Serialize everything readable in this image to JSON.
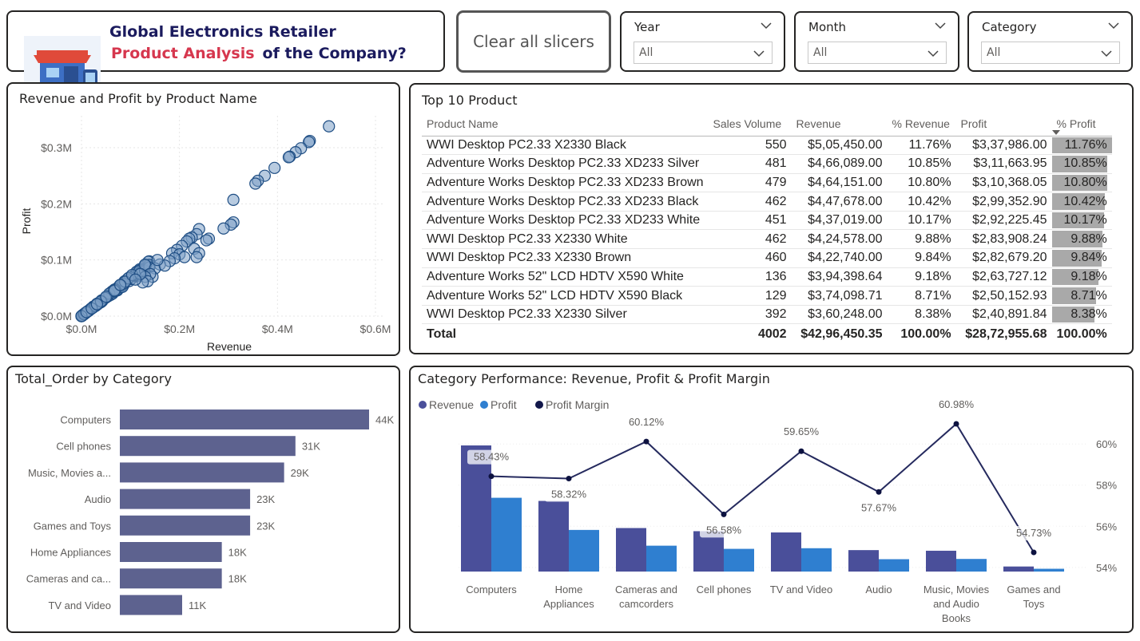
{
  "header": {
    "title_line1": "Global Electronics Retailer",
    "title_red": "Product Analysis",
    "title_rest": "of the Company?"
  },
  "clear_button": "Clear all slicers",
  "slicers": {
    "year": {
      "label": "Year",
      "value": "All"
    },
    "month": {
      "label": "Month",
      "value": "All"
    },
    "category": {
      "label": "Category",
      "value": "All"
    }
  },
  "scatter": {
    "title": "Revenue and Profit by Product Name",
    "xlabel": "Revenue",
    "ylabel": "Profit",
    "xticks": [
      "$0.0M",
      "$0.2M",
      "$0.4M",
      "$0.6M"
    ],
    "yticks": [
      "$0.0M",
      "$0.1M",
      "$0.2M",
      "$0.3M"
    ]
  },
  "top10": {
    "title": "Top 10 Product",
    "columns": [
      "Product Name",
      "Sales Volume",
      "Revenue",
      "% Revenue",
      "Profit",
      "% Profit"
    ],
    "rows": [
      [
        "WWI Desktop PC2.33 X2330 Black",
        "550",
        "$5,05,450.00",
        "11.76%",
        "$3,37,986.00",
        "11.76%"
      ],
      [
        "Adventure Works Desktop PC2.33 XD233 Silver",
        "481",
        "$4,66,089.00",
        "10.85%",
        "$3,11,663.95",
        "10.85%"
      ],
      [
        "Adventure Works Desktop PC2.33 XD233 Brown",
        "479",
        "$4,64,151.00",
        "10.80%",
        "$3,10,368.05",
        "10.80%"
      ],
      [
        "Adventure Works Desktop PC2.33 XD233 Black",
        "462",
        "$4,47,678.00",
        "10.42%",
        "$2,99,352.90",
        "10.42%"
      ],
      [
        "Adventure Works Desktop PC2.33 XD233 White",
        "451",
        "$4,37,019.00",
        "10.17%",
        "$2,92,225.45",
        "10.17%"
      ],
      [
        "WWI Desktop PC2.33 X2330 White",
        "462",
        "$4,24,578.00",
        "9.88%",
        "$2,83,908.24",
        "9.88%"
      ],
      [
        "WWI Desktop PC2.33 X2330 Brown",
        "460",
        "$4,22,740.00",
        "9.84%",
        "$2,82,679.20",
        "9.84%"
      ],
      [
        "Adventure Works 52\" LCD HDTV X590 White",
        "136",
        "$3,94,398.64",
        "9.18%",
        "$2,63,727.12",
        "9.18%"
      ],
      [
        "Adventure Works 52\" LCD HDTV X590 Black",
        "129",
        "$3,74,098.71",
        "8.71%",
        "$2,50,152.93",
        "8.71%"
      ],
      [
        "WWI Desktop PC2.33 X2330 Silver",
        "392",
        "$3,60,248.00",
        "8.38%",
        "$2,40,891.84",
        "8.38%"
      ]
    ],
    "profit_share": [
      11.76,
      10.85,
      10.8,
      10.42,
      10.17,
      9.88,
      9.84,
      9.18,
      8.71,
      8.38
    ],
    "total": [
      "Total",
      "4002",
      "$42,96,450.35",
      "100.00%",
      "$28,72,955.68",
      "100.00%"
    ]
  },
  "orders": {
    "title": "Total_Order by Category",
    "categories": [
      "Computers",
      "Cell phones",
      "Music, Movies a...",
      "Audio",
      "Games and Toys",
      "Home Appliances",
      "Cameras and ca...",
      "TV and Video"
    ],
    "values": [
      44,
      31,
      29,
      23,
      23,
      18,
      18,
      11
    ],
    "labels": [
      "44K",
      "31K",
      "29K",
      "23K",
      "23K",
      "18K",
      "18K",
      "11K"
    ],
    "bar_color": "#5d628f"
  },
  "combo": {
    "title": "Category Performance: Revenue, Profit & Profit Margin",
    "legend": [
      {
        "name": "Revenue",
        "color": "#4a4f9a"
      },
      {
        "name": "Profit",
        "color": "#2f7fd0"
      },
      {
        "name": "Profit Margin",
        "color": "#12174a"
      }
    ],
    "categories": [
      [
        "Computers"
      ],
      [
        "Home",
        "Appliances"
      ],
      [
        "Cameras and",
        "camcorders"
      ],
      [
        "Cell phones"
      ],
      [
        "TV and Video"
      ],
      [
        "Audio"
      ],
      [
        "Music, Movies",
        "and Audio",
        "Books"
      ],
      [
        "Games and",
        "Toys"
      ]
    ],
    "margin_labels": [
      "58.43%",
      "58.32%",
      "60.12%",
      "56.58%",
      "59.65%",
      "57.67%",
      "60.98%",
      "54.73%"
    ],
    "margins": [
      58.43,
      58.32,
      60.12,
      56.58,
      59.65,
      57.67,
      60.98,
      54.73
    ],
    "revenue_rel": [
      1.0,
      0.56,
      0.345,
      0.32,
      0.31,
      0.17,
      0.165,
      0.04
    ],
    "profit_rel": [
      0.585,
      0.33,
      0.205,
      0.18,
      0.185,
      0.098,
      0.1,
      0.022
    ],
    "yticks": [
      "60%",
      "58%",
      "56%",
      "54%"
    ]
  }
}
